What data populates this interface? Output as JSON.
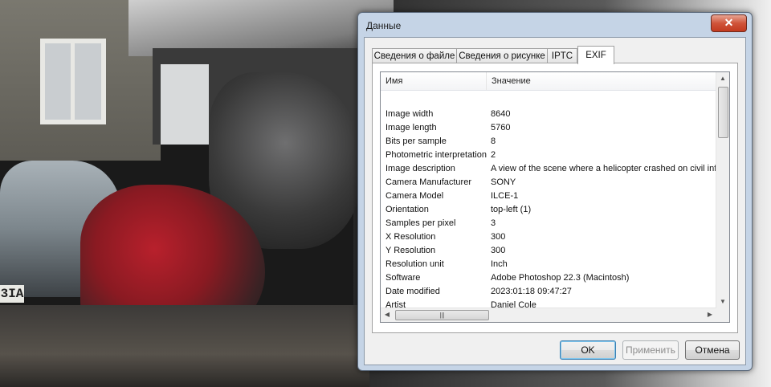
{
  "background": {
    "plate_text": "3IA"
  },
  "dialog": {
    "title": "Данные",
    "close_glyph": "✕",
    "tabs": [
      {
        "label": "Сведения о файле",
        "active": false
      },
      {
        "label": "Сведения о рисунке",
        "active": false
      },
      {
        "label": "IPTC",
        "active": false
      },
      {
        "label": "EXIF",
        "active": true
      }
    ],
    "table": {
      "columns": [
        "Имя",
        "Значение"
      ],
      "rows": [
        {
          "name": "",
          "value": ""
        },
        {
          "name": "Image width",
          "value": "8640"
        },
        {
          "name": "Image length",
          "value": "5760"
        },
        {
          "name": "Bits per sample",
          "value": "8"
        },
        {
          "name": "Photometric interpretation",
          "value": "2"
        },
        {
          "name": "Image description",
          "value": "A view of the scene where a helicopter crashed on civil infra"
        },
        {
          "name": "Camera Manufacturer",
          "value": "SONY"
        },
        {
          "name": "Camera Model",
          "value": "ILCE-1"
        },
        {
          "name": "Orientation",
          "value": "top-left (1)"
        },
        {
          "name": "Samples per pixel",
          "value": "3"
        },
        {
          "name": "X Resolution",
          "value": "300"
        },
        {
          "name": "Y Resolution",
          "value": "300"
        },
        {
          "name": "Resolution unit",
          "value": "Inch"
        },
        {
          "name": "Software",
          "value": "Adobe Photoshop 22.3 (Macintosh)"
        },
        {
          "name": "Date modified",
          "value": "2023:01:18 09:47:27"
        },
        {
          "name": "Artist",
          "value": "Daniel Cole"
        }
      ]
    },
    "scroll": {
      "up_glyph": "▲",
      "down_glyph": "▼",
      "left_glyph": "◀",
      "right_glyph": "▶",
      "hthumb_grip": "|||",
      "vthumb_grip": "≡"
    },
    "buttons": {
      "ok": "OK",
      "apply": "Применить",
      "cancel": "Отмена"
    }
  }
}
